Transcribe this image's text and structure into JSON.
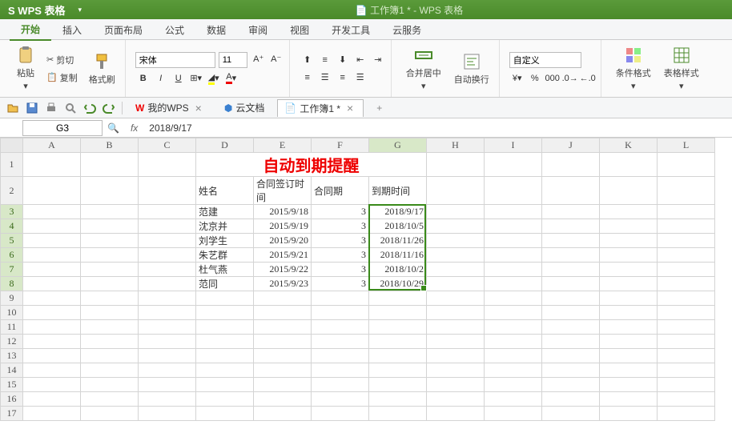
{
  "app": {
    "name": "WPS 表格",
    "title": "工作簿1 * - WPS 表格"
  },
  "menus": {
    "start": "开始",
    "insert": "插入",
    "layout": "页面布局",
    "formula": "公式",
    "data": "数据",
    "review": "审阅",
    "view": "视图",
    "dev": "开发工具",
    "cloud": "云服务"
  },
  "ribbon": {
    "paste": "粘贴",
    "cut": "剪切",
    "copy": "复制",
    "fmtpaint": "格式刷",
    "font": "宋体",
    "fontsize": "11",
    "merge": "合并居中",
    "wrap": "自动换行",
    "numfmt": "自定义",
    "cond": "条件格式",
    "tablestyle": "表格样式"
  },
  "qat": {
    "mywps": "我的WPS",
    "clouddoc": "云文档",
    "workbook": "工作簿1 *"
  },
  "cell": {
    "ref": "G3",
    "value": "2018/9/17"
  },
  "cols": [
    "A",
    "B",
    "C",
    "D",
    "E",
    "F",
    "G",
    "H",
    "I",
    "J",
    "K",
    "L"
  ],
  "headers": {
    "name": "姓名",
    "signdate": "合同签订时间",
    "term": "合同期",
    "due": "到期时间"
  },
  "title_text": "自动到期提醒",
  "rows": [
    {
      "name": "范建",
      "sign": "2015/9/18",
      "term": "3",
      "due": "2018/9/17"
    },
    {
      "name": "沈京并",
      "sign": "2015/9/19",
      "term": "3",
      "due": "2018/10/5"
    },
    {
      "name": "刘学生",
      "sign": "2015/9/20",
      "term": "3",
      "due": "2018/11/26"
    },
    {
      "name": "朱艺群",
      "sign": "2015/9/21",
      "term": "3",
      "due": "2018/11/16"
    },
    {
      "name": "杜气燕",
      "sign": "2015/9/22",
      "term": "3",
      "due": "2018/10/2"
    },
    {
      "name": "范同",
      "sign": "2015/9/23",
      "term": "3",
      "due": "2018/10/29"
    }
  ],
  "selected_col": "G",
  "selected_rows": [
    3,
    4,
    5,
    6,
    7,
    8
  ]
}
